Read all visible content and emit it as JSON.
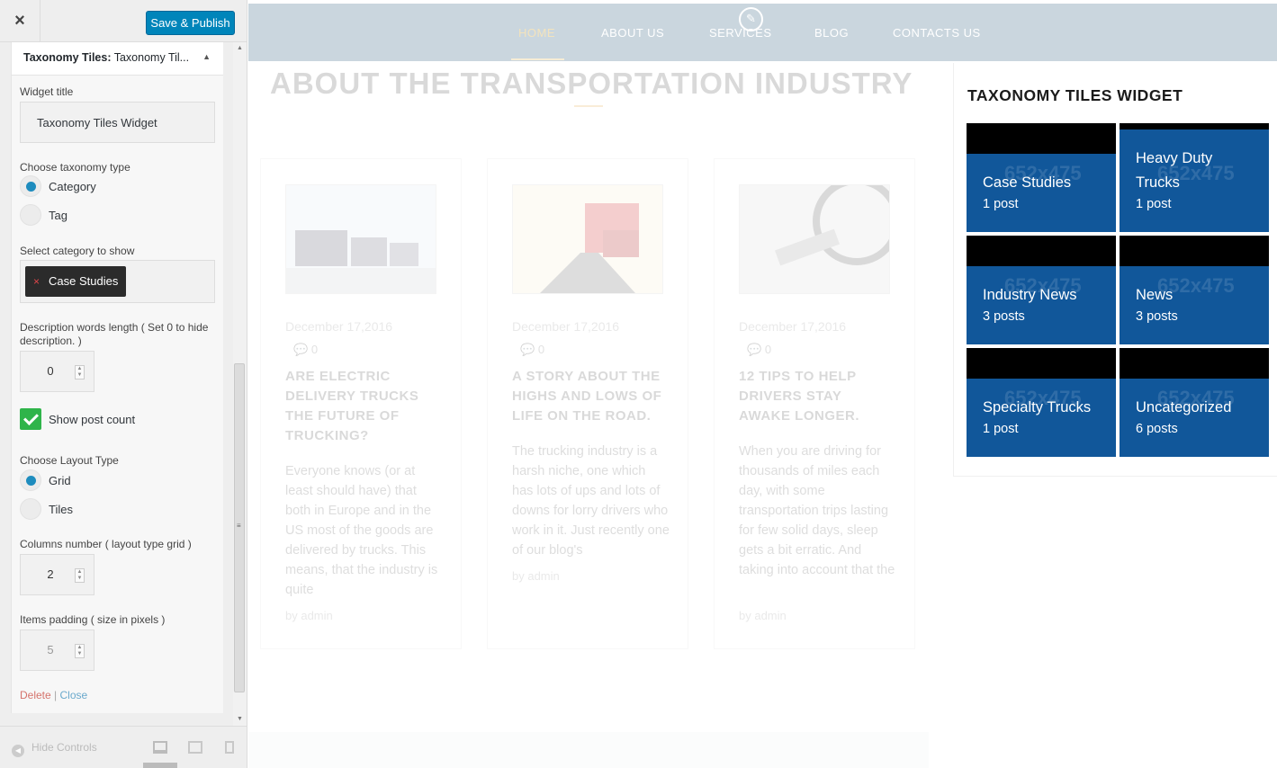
{
  "customizer": {
    "close_icon": "×",
    "publish_label": "Save & Publish",
    "widget_header": {
      "bold": "Taxonomy Tiles:",
      "rest": " Taxonomy Til..."
    },
    "fields": {
      "title_label": "Widget title",
      "title_value": "Taxonomy Tiles Widget",
      "taxonomy_label": "Choose taxonomy type",
      "taxonomy_options": [
        "Category",
        "Tag"
      ],
      "taxonomy_selected": "Category",
      "category_label": "Select category to show",
      "category_chip": "Case Studies",
      "category_chip_remove": "×",
      "desc_label": "Description words length ( Set 0 to hide description. )",
      "desc_value": "0",
      "show_count_label": "Show post count",
      "show_count_checked": true,
      "layout_label": "Choose Layout Type",
      "layout_options": [
        "Grid",
        "Tiles"
      ],
      "layout_selected": "Grid",
      "columns_label": "Columns number ( layout type grid )",
      "columns_value": "2",
      "padding_label": "Items padding ( size in pixels )",
      "padding_value": "5"
    },
    "delete_label": "Delete",
    "separator": "|",
    "close_label": "Close",
    "hide_controls_label": "Hide Controls",
    "preview_device_selected": "desktop"
  },
  "preview": {
    "nav": {
      "items": [
        "HOME",
        "ABOUT US",
        "SERVICES",
        "BLOG",
        "CONTACTS US"
      ],
      "active": "HOME"
    },
    "section_title": "ABOUT THE TRANSPORTATION INDUSTRY",
    "posts": [
      {
        "date": "December 17,2016",
        "comments": "0",
        "title": "ARE ELECTRIC DELIVERY TRUCKS THE FUTURE OF TRUCKING?",
        "excerpt": "Everyone knows (or at least should have) that both in Europe and in the US most of the goods are delivered by trucks. This means, that the industry is quite",
        "author": "by admin"
      },
      {
        "date": "December 17,2016",
        "comments": "0",
        "title": "A STORY ABOUT THE HIGHS AND LOWS OF LIFE ON THE ROAD.",
        "excerpt": "The trucking industry is a harsh niche, one which has lots of ups and lots of downs for lorry drivers who work in it. Just recently one of our blog's",
        "author": "by admin"
      },
      {
        "date": "December 17,2016",
        "comments": "0",
        "title": "12 TIPS TO HELP DRIVERS STAY AWAKE LONGER.",
        "excerpt": "When you are driving for thousands of miles each day, with some transportation trips lasting for few solid days, sleep gets a bit erratic. And taking into account that the",
        "author": "by admin"
      }
    ],
    "widget": {
      "title": "TAXONOMY TILES WIDGET",
      "placeholder_text": "652x475",
      "tiles": [
        {
          "name": "Case Studies",
          "count": "1 post"
        },
        {
          "name": "Heavy Duty Trucks",
          "count": "1 post"
        },
        {
          "name": "Industry News",
          "count": "3 posts"
        },
        {
          "name": "News",
          "count": "3 posts"
        },
        {
          "name": "Specialty Trucks",
          "count": "1 post"
        },
        {
          "name": "Uncategorized",
          "count": "6 posts"
        }
      ]
    }
  },
  "colors": {
    "publish_button": "#0085ba",
    "tile_bg": "#11579a",
    "nav_bg": "#cad6de",
    "checkbox": "#2fb44a"
  }
}
